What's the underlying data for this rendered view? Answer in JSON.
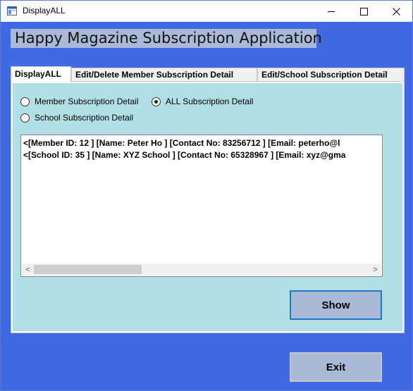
{
  "window": {
    "title": "DisplayALL",
    "minimize_glyph": "—",
    "maximize_glyph": "☐",
    "close_glyph": "✕"
  },
  "header": {
    "title": "Happy Magazine Subscription Application"
  },
  "tabs": [
    {
      "label": "DisplayALL",
      "active": true
    },
    {
      "label": "Edit/Delete Member Subscription Detail",
      "active": false
    },
    {
      "label": "Edit/School Subscription Detail",
      "active": false
    }
  ],
  "radios": {
    "member": {
      "label": "Member Subscription Detail",
      "checked": false
    },
    "all": {
      "label": "ALL Subscription Detail",
      "checked": true
    },
    "school": {
      "label": "School Subscription Detail",
      "checked": false
    }
  },
  "list": {
    "lines": [
      "<[Member ID: 12 ] [Name: Peter Ho ] [Contact No: 83256712 ] [Email: peterho@l",
      "<[School ID: 35 ] [Name: XYZ School ] [Contact No: 65328967 ] [Email: xyz@gma"
    ],
    "scroll_left_glyph": "<",
    "scroll_right_glyph": ">"
  },
  "buttons": {
    "show": "Show",
    "exit": "Exit"
  },
  "colors": {
    "form_background": "#4169e1",
    "tab_page_background": "#b0dfe6",
    "button_background": "#a9b9d6",
    "header_background": "#a9b9d6"
  }
}
